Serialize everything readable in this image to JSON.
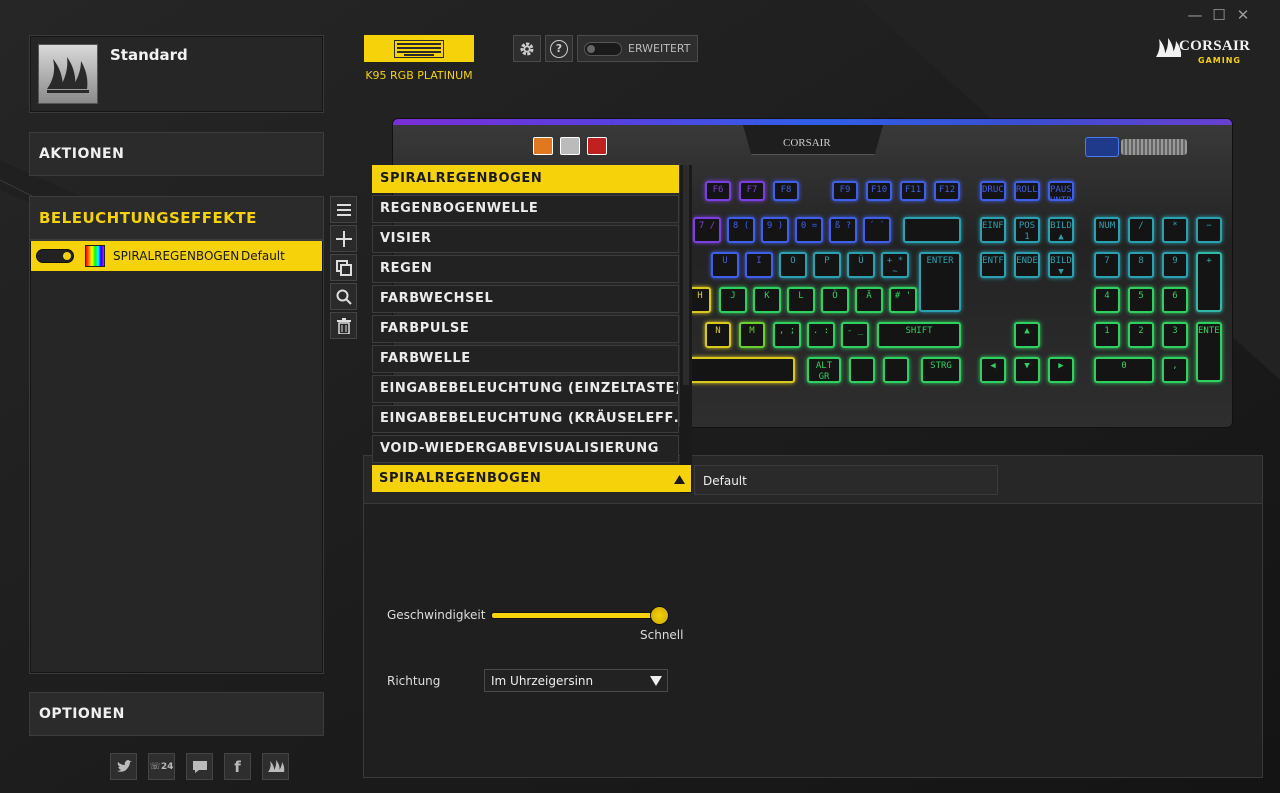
{
  "window": {
    "minimize": "—",
    "maximize": "☐",
    "close": "✕"
  },
  "profile": {
    "name": "Standard"
  },
  "sections": {
    "actions": "AKTIONEN",
    "lighting": "BELEUCHTUNGSEFFEKTE",
    "options": "OPTIONEN"
  },
  "effect_row": {
    "name": "SPIRALREGENBOGEN",
    "profile": "Default"
  },
  "device": {
    "name": "K95 RGB PLATINUM"
  },
  "header": {
    "advanced_label": "ERWEITERT",
    "help_label": "?"
  },
  "brand": {
    "name": "CORSAIR",
    "sub": "GAMING"
  },
  "dropdown": {
    "items": [
      "SPIRALREGENBOGEN",
      "REGENBOGENWELLE",
      "VISIER",
      "REGEN",
      "FARBWECHSEL",
      "FARBPULSE",
      "FARBWELLE",
      "EINGABEBELEUCHTUNG (EINZELTASTE)",
      "EINGABEBELEUCHTUNG (KRÄUSELEFF…",
      "VOID-WIEDERGABEVISUALISIERUNG"
    ],
    "selected": "SPIRALREGENBOGEN"
  },
  "settings": {
    "profile_tab": "Default",
    "speed_label": "Geschwindigkeit",
    "speed_value_label": "Schnell",
    "speed_level": 1.0,
    "direction_label": "Richtung",
    "direction_value": "Im Uhrzeigersinn"
  },
  "keyboard": {
    "logo": "CORSAIR",
    "keys": {
      "f6": "F6",
      "f7": "F7",
      "f8": "F8",
      "f9": "F9",
      "f10": "F10",
      "f11": "F11",
      "f12": "F12",
      "druck": "DRUCK",
      "rollen": "ROLLEN",
      "pause": "PAUSE UNTBR",
      "k7": "7 /",
      "k8": "8 (",
      "k9": "9 )",
      "k0": "0 =",
      "ss": "ß ?",
      "acc": "´ `",
      "einfg": "EINFG",
      "pos1": "POS 1",
      "bild_up": "BILD ▲",
      "num": "NUM",
      "div": "/",
      "mul": "*",
      "sub": "−",
      "u": "U",
      "i": "I",
      "o": "O",
      "p": "P",
      "ue": "Ü",
      "plus": "+ * ~",
      "enter": "ENTER",
      "entf": "ENTF",
      "ende": "ENDE",
      "bild_dn": "BILD ▼",
      "n7": "7",
      "n8": "8",
      "n9": "9",
      "nplus": "+",
      "h": "H",
      "j": "J",
      "k": "K",
      "l": "L",
      "oe": "Ö",
      "ae": "Ä",
      "hash": "# '",
      "n4": "4",
      "n5": "5",
      "n6": "6",
      "n": "N",
      "m": "M",
      "comma": ", ;",
      "dot": ". :",
      "dash": "- _",
      "shift": "SHIFT",
      "up": "▲",
      "n1": "1",
      "n2": "2",
      "n3": "3",
      "nenter": "ENTER",
      "altgr": "ALT GR",
      "strg": "STRG",
      "left": "◀",
      "down": "▼",
      "right": "▶",
      "n0": "0",
      "ndot": ","
    }
  },
  "colors": {
    "accent": "#f6d20b",
    "panel": "#262626"
  }
}
